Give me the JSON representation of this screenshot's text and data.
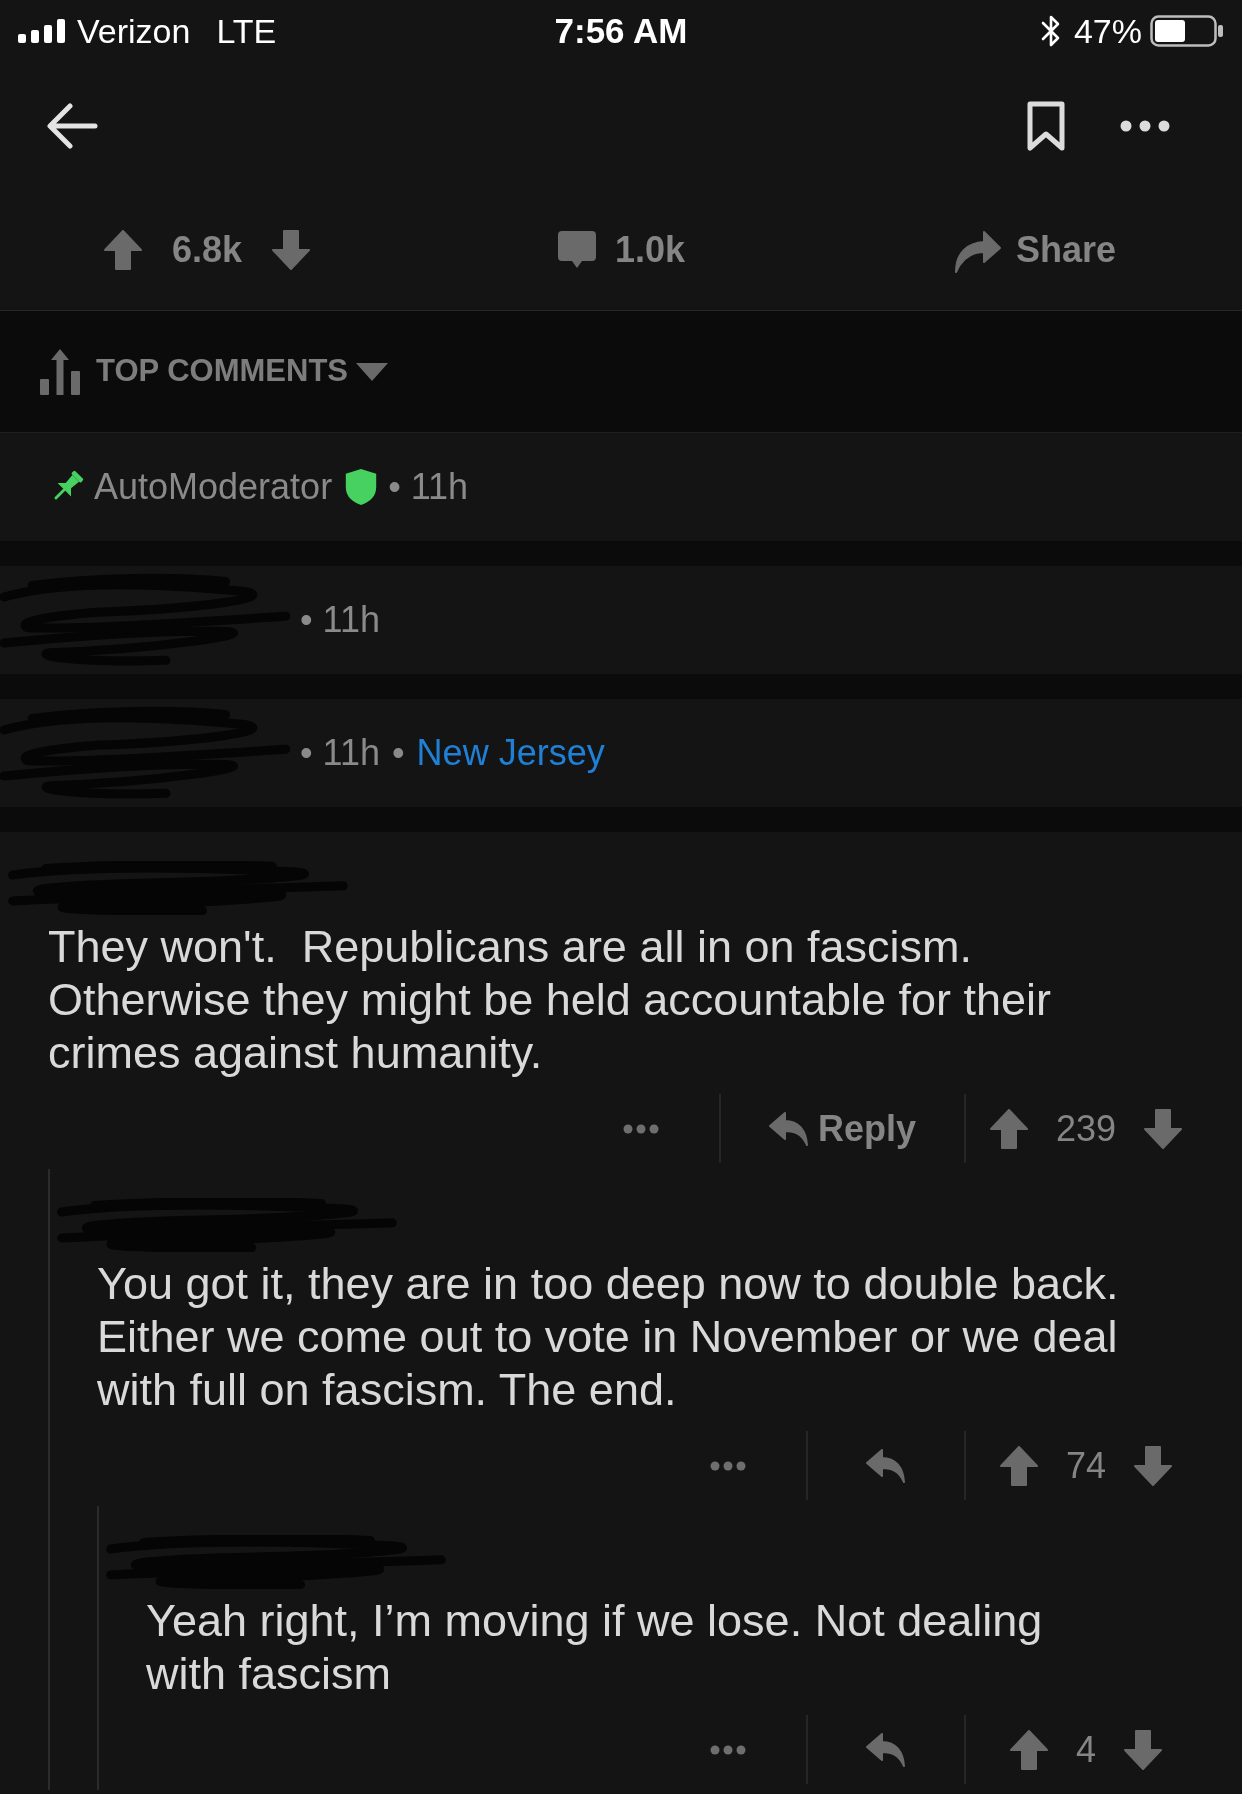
{
  "status_bar": {
    "carrier": "Verizon",
    "network": "LTE",
    "time": "7:56 AM",
    "battery": "47%"
  },
  "post_actions": {
    "score": "6.8k",
    "comment_count": "1.0k",
    "share_label": "Share"
  },
  "sort": {
    "label": "TOP COMMENTS"
  },
  "comments": [
    {
      "kind": "collapsed",
      "author": "AutoModerator",
      "author_redacted": false,
      "pinned": true,
      "moderator": true,
      "time": "• 11h"
    },
    {
      "kind": "collapsed",
      "author_redacted": true,
      "pinned": false,
      "moderator": false,
      "time": "• 11h"
    },
    {
      "kind": "collapsed",
      "author_redacted": true,
      "pinned": false,
      "moderator": false,
      "time": "• 11h",
      "flair_separator": "•",
      "flair": "New Jersey"
    },
    {
      "kind": "expanded",
      "author_redacted": true,
      "body": "They won't.  Republicans are all in on fascism. Otherwise they might be held accountable for their crimes against humanity.",
      "reply_label": "Reply",
      "score": "239",
      "children": [
        {
          "kind": "expanded",
          "author_redacted": true,
          "body": "You got it, they are in too deep now to double back. Either we come out to vote in November or we deal with full on fascism. The end.",
          "score": "74",
          "children": [
            {
              "kind": "expanded",
              "author_redacted": true,
              "body": "Yeah right, I’m moving if we lose. Not dealing with fascism",
              "score": "4"
            }
          ]
        }
      ]
    }
  ]
}
